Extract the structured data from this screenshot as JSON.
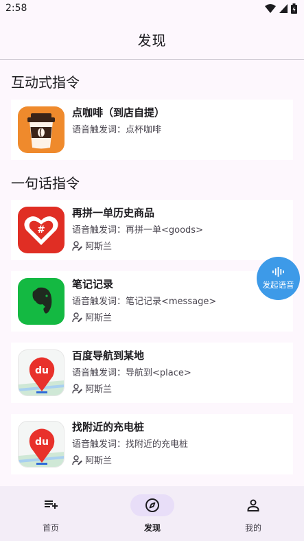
{
  "status": {
    "time": "2:58"
  },
  "header": {
    "title": "发现"
  },
  "interactive": {
    "title": "互动式指令",
    "items": [
      {
        "title": "点咖啡（到店自提）",
        "trigger": "语音触发词：点杯咖啡",
        "icon": "coffee-cup-icon"
      }
    ]
  },
  "oneshot": {
    "title": "一句话指令",
    "items": [
      {
        "title": "再拼一单历史商品",
        "trigger": "语音触发词：再拼一单<goods>",
        "author": "阿斯兰",
        "icon": "pinduoduo-icon"
      },
      {
        "title": "笔记记录",
        "trigger": "语音触发词：笔记记录<message>",
        "author": "阿斯兰",
        "icon": "evernote-elephant-icon"
      },
      {
        "title": "百度导航到某地",
        "trigger": "语音触发词：导航到<place>",
        "author": "阿斯兰",
        "icon": "baidu-map-icon"
      },
      {
        "title": "找附近的充电桩",
        "trigger": "语音触发词：找附近的充电桩",
        "author": "阿斯兰",
        "icon": "baidu-map-icon"
      }
    ]
  },
  "fab": {
    "label": "发起语音",
    "icon": "voice-wave-icon"
  },
  "nav": {
    "items": [
      {
        "label": "首页",
        "icon": "playlist-add-icon",
        "active": false
      },
      {
        "label": "发现",
        "icon": "compass-icon",
        "active": true
      },
      {
        "label": "我的",
        "icon": "person-icon",
        "active": false
      }
    ]
  },
  "colors": {
    "accent": "#3d9ae8",
    "background": "#fdf7fd",
    "nav_background": "#f3edf7",
    "nav_active": "#e8def8"
  }
}
